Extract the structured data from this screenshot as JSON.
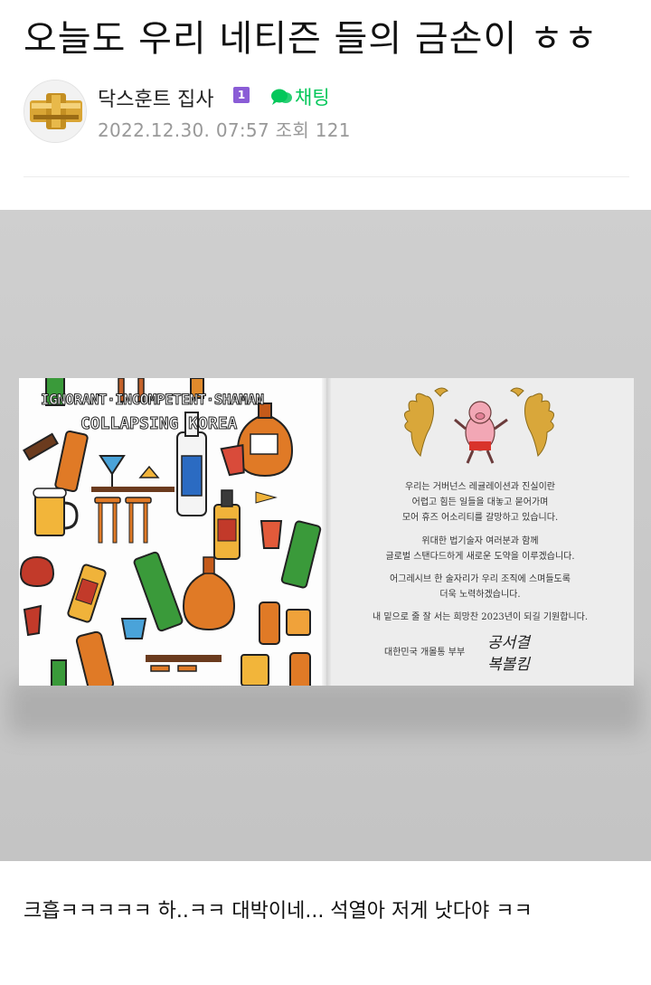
{
  "post": {
    "title": "오늘도 우리 네티즌 들의 금손이 ㅎㅎ"
  },
  "author": {
    "name": "닥스훈트 집사",
    "level_badge": "1",
    "chat_label": "채팅",
    "date": "2022.12.30. 07:57",
    "views_label": "조회 121"
  },
  "card": {
    "headline": "IGNORANT·INCOMPETENT·SHAMAN",
    "subline": "COLLAPSING KOREA",
    "paragraphs": [
      [
        "우리는 거버넌스 레귤레이션과 진실이란",
        "어렵고 힘든 일들을 대놓고 묻어가며",
        "모어 휴즈 어소리티를 갈망하고 있습니다."
      ],
      [
        "위대한 법기술자 여러분과 함께",
        "글로벌 스탠다드하게 새로운 도약을 이루겠습니다."
      ],
      [
        "어그레시브 한 술자리가 우리 조직에 스며들도록",
        "더욱 노력하겠습니다."
      ],
      [
        "내 밑으로 줄 잘 서는 희망찬 2023년이 되길 기원합니다."
      ]
    ],
    "signature_label": "대한민국 개몰통 부부",
    "signature_line1": "공서결",
    "signature_line2": "복볼킴"
  },
  "comment": {
    "text": "크흡ㅋㅋㅋㅋㅋ 하..ㅋㅋ  대박이네...  석열아 저게 낫다야 ㅋㅋ"
  },
  "colors": {
    "accent_green": "#03c75a",
    "badge_purple": "#8a5cd6",
    "meta_gray": "#999999"
  }
}
